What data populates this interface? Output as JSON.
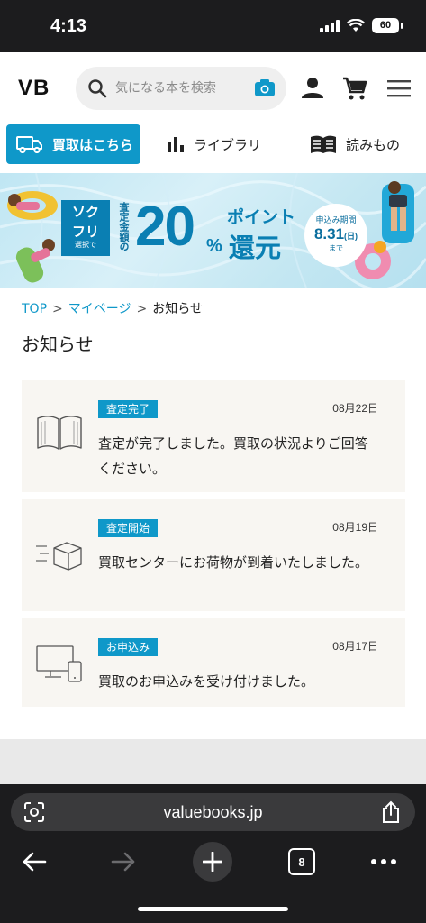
{
  "status_bar": {
    "time": "4:13",
    "battery": "60"
  },
  "header": {
    "logo": "VB",
    "search": {
      "placeholder": "気になる本を検索",
      "value": ""
    }
  },
  "nav": {
    "buyback_label": "買取はこちら",
    "library_label": "ライブラリ",
    "reading_label": "読みもの"
  },
  "banner": {
    "soku_line1": "ソク",
    "soku_line2": "フリ",
    "soku_line3": "選択で",
    "assess_label": "査定金額の",
    "big_value": "20",
    "percent_sign": "%",
    "point_label": "ポイント",
    "return_label": "還元",
    "period_label": "申込み期間",
    "period_date": "8.31",
    "period_day": "(日)",
    "period_until": "まで"
  },
  "breadcrumb": {
    "top": "TOP",
    "sep1": ">",
    "mypage": "マイページ",
    "sep2": ">",
    "current": "お知らせ"
  },
  "page_title": "お知らせ",
  "notices": [
    {
      "tag": "査定完了",
      "date": "08月22日",
      "message": "査定が完了しました。買取の状況よりご回答ください。",
      "icon": "book-icon"
    },
    {
      "tag": "査定開始",
      "date": "08月19日",
      "message": "買取センターにお荷物が到着いたしました。",
      "icon": "box-delivery-icon"
    },
    {
      "tag": "お申込み",
      "date": "08月17日",
      "message": "買取のお申込みを受け付けました。",
      "icon": "devices-icon"
    }
  ],
  "browser": {
    "url": "valuebooks.jp",
    "tab_count": "8"
  },
  "colors": {
    "accent": "#0f98c9",
    "notice_bg": "#f8f6f2",
    "dark_bar": "#1c1c1e"
  }
}
